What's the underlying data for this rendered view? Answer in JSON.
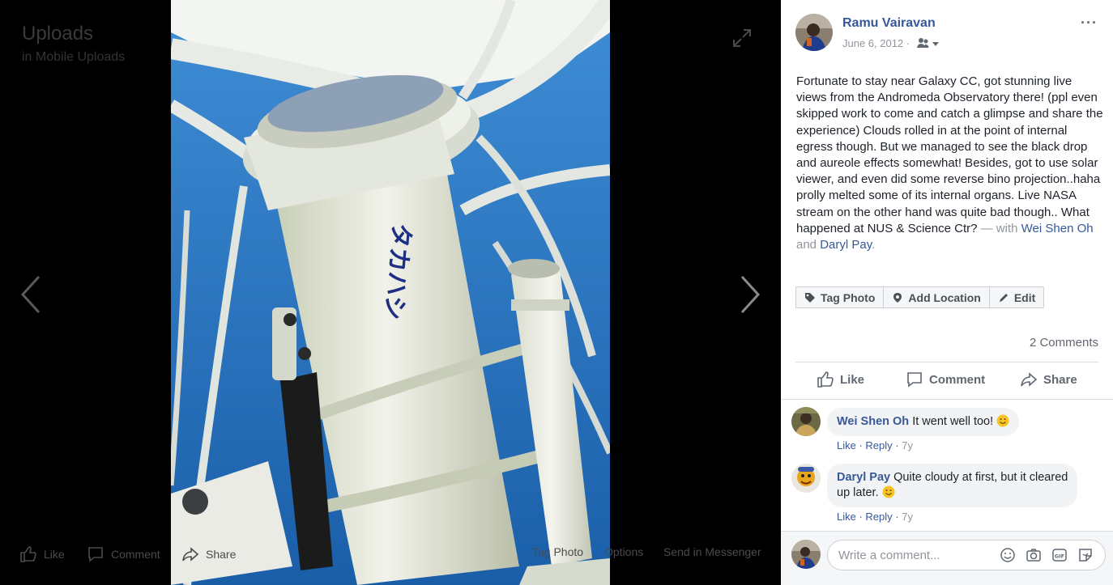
{
  "viewer": {
    "album_title": "Uploads",
    "album_subtitle": "in Mobile Uploads",
    "actions": {
      "like": "Like",
      "comment": "Comment",
      "share": "Share",
      "tag_photo": "Tag Photo",
      "options": "Options",
      "send_messenger": "Send in Messenger"
    },
    "photo_brand_text": "タカハシ"
  },
  "post": {
    "author": "Ramu Vairavan",
    "date": "June 6, 2012 ·",
    "caption_text": "Fortunate to stay near Galaxy CC, got stunning live views from the Andromeda Observatory there! (ppl even skipped work to come and catch a glimpse and share the experience) Clouds rolled in at the point of internal egress though. But we managed to see the black drop and aureole effects somewhat! Besides, got to use solar viewer, and even did some reverse bino projection..haha prolly melted some of its internal organs. Live NASA stream on the other hand was quite bad though.. What happened at NUS & Science Ctr?",
    "with_text": " — with ",
    "tagged_1": "Wei Shen Oh",
    "and_text": " and ",
    "tagged_2": "Daryl Pay",
    "period": ".",
    "more": "···"
  },
  "tag_bar": {
    "tag_photo": "Tag Photo",
    "add_location": "Add Location",
    "edit": "Edit"
  },
  "stats": {
    "comments_count": "2 Comments"
  },
  "actions": {
    "like": "Like",
    "comment": "Comment",
    "share": "Share"
  },
  "comments": [
    {
      "author": "Wei Shen Oh",
      "text": "It went well too!",
      "like": "Like",
      "reply": "Reply",
      "time": "7y"
    },
    {
      "author": "Daryl Pay",
      "text_line1": "Quite cloudy at first, but it cleared",
      "text_line2": "up later.",
      "like": "Like",
      "reply": "Reply",
      "time": "7y"
    }
  ],
  "comment_input": {
    "placeholder": "Write a comment..."
  },
  "colors": {
    "link": "#365899",
    "sky": "#1f6fb5",
    "panel_bg": "#ffffff"
  }
}
